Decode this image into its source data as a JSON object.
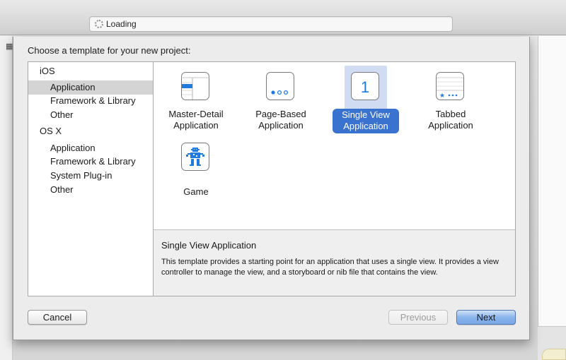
{
  "toolbar": {
    "activity_text": "Loading"
  },
  "sheet": {
    "title": "Choose a template for your new project:"
  },
  "sidebar": {
    "groups": [
      {
        "label": "iOS",
        "items": [
          "Application",
          "Framework & Library",
          "Other"
        ]
      },
      {
        "label": "OS X",
        "items": [
          "Application",
          "Framework & Library",
          "System Plug-in",
          "Other"
        ]
      }
    ],
    "selected": "iOS / Application"
  },
  "templates": [
    {
      "line1": "Master-Detail",
      "line2": "Application",
      "icon": "master-detail-icon"
    },
    {
      "line1": "Page-Based",
      "line2": "Application",
      "icon": "page-based-icon"
    },
    {
      "line1": "Single View",
      "line2": "Application",
      "icon": "single-view-icon",
      "icon_text": "1",
      "selected": true
    },
    {
      "line1": "Tabbed",
      "line2": "Application",
      "icon": "tabbed-icon"
    },
    {
      "line1": "Game",
      "line2": "",
      "icon": "game-icon"
    }
  ],
  "description": {
    "title": "Single View Application",
    "text": "This template provides a starting point for an application that uses a single view. It provides a view controller to manage the view, and a storyboard or nib file that contains the view."
  },
  "buttons": {
    "cancel": "Cancel",
    "previous": "Previous",
    "next": "Next"
  },
  "colors": {
    "selection_blue": "#3a72cf",
    "icon_blue": "#1f7be0"
  }
}
